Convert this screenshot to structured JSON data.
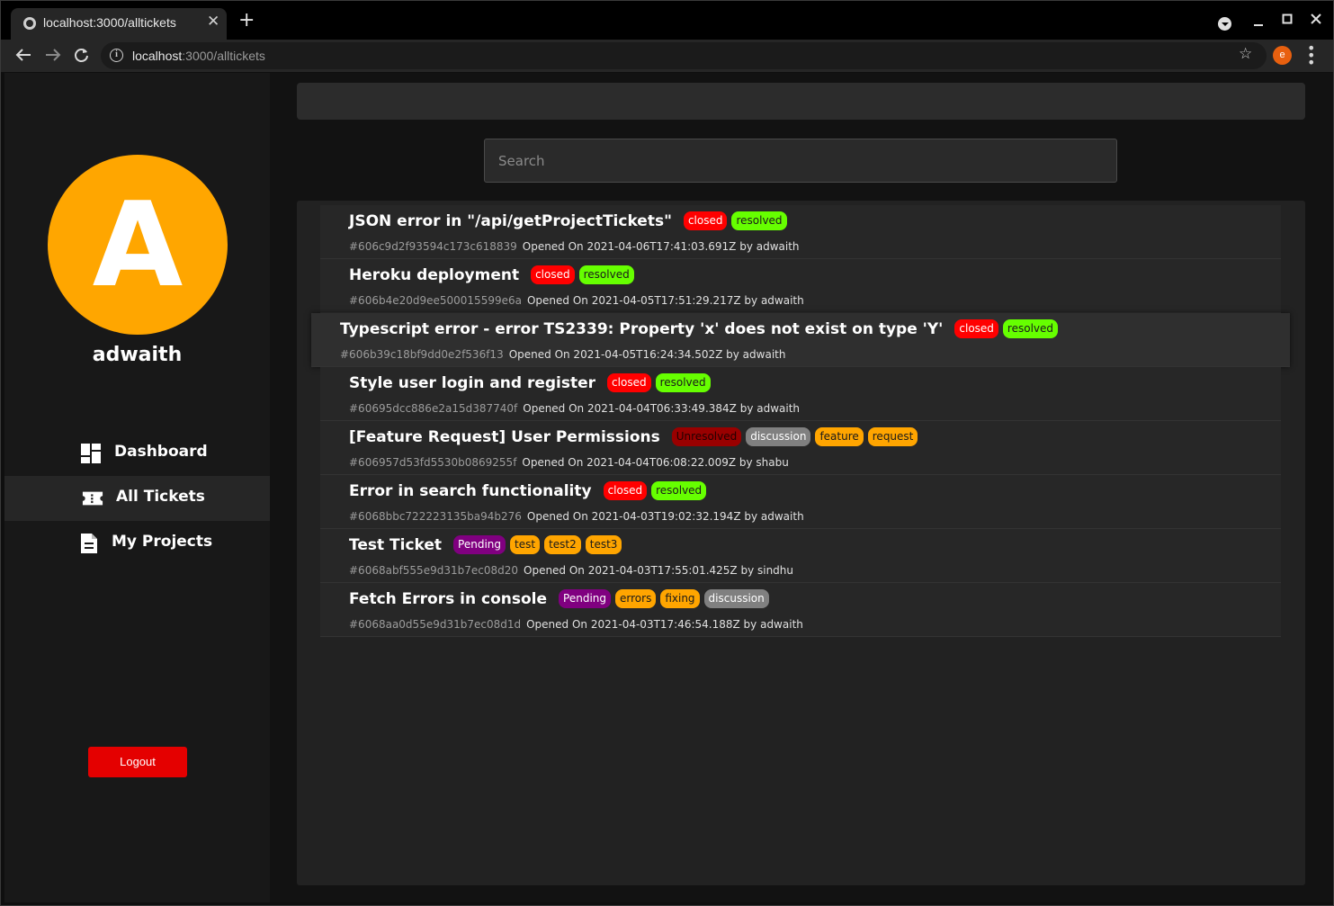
{
  "browser": {
    "tab_title": "localhost:3000/alltickets",
    "tab_close": "✕",
    "new_tab": "+",
    "url_host": "localhost",
    "url_path": ":3000/alltickets",
    "profile_initial": "e",
    "icons": [
      "globe-icon",
      "back-icon",
      "forward-icon",
      "reload-icon",
      "info-icon",
      "star-icon",
      "kebab-icon",
      "minimize-icon",
      "maximize-icon",
      "close-icon"
    ]
  },
  "sidebar": {
    "avatar_letter": "A",
    "avatar_color": "#ffa600",
    "username": "adwaith",
    "nav": [
      {
        "label": "Dashboard",
        "icon": "dashboard-icon",
        "active": false
      },
      {
        "label": "All Tickets",
        "icon": "ticket-icon",
        "active": true
      },
      {
        "label": "My Projects",
        "icon": "document-icon",
        "active": false
      }
    ],
    "logout_label": "Logout",
    "logout_color": "#e40000"
  },
  "search": {
    "placeholder": "Search"
  },
  "badge_colors": {
    "closed": {
      "bg": "#ff0000",
      "fg": "#ffffff"
    },
    "resolved": {
      "bg": "#66ff00",
      "fg": "#1a1a1a"
    },
    "Unresolved": {
      "bg": "#990000",
      "fg": "#220000"
    },
    "discussion": {
      "bg": "#808080",
      "fg": "#ffffff"
    },
    "Pending": {
      "bg": "#800080",
      "fg": "#ffffff"
    },
    "orange": {
      "bg": "#ffa500",
      "fg": "#1a1a1a"
    }
  },
  "tickets": [
    {
      "title": "JSON error in \"/api/getProjectTickets\"",
      "tags": [
        "closed",
        "resolved"
      ],
      "id": "#606c9d2f93594c173c618839",
      "opened": "Opened On 2021-04-06T17:41:03.691Z by adwaith"
    },
    {
      "title": "Heroku deployment",
      "tags": [
        "closed",
        "resolved"
      ],
      "id": "#606b4e20d9ee500015599e6a",
      "opened": "Opened On 2021-04-05T17:51:29.217Z by adwaith"
    },
    {
      "title": "Typescript error - error TS2339: Property 'x' does not exist on type 'Y'",
      "tags": [
        "closed",
        "resolved"
      ],
      "id": "#606b39c18bf9dd0e2f536f13",
      "opened": "Opened On 2021-04-05T16:24:34.502Z by adwaith"
    },
    {
      "title": "Style user login and register",
      "tags": [
        "closed",
        "resolved"
      ],
      "id": "#60695dcc886e2a15d387740f",
      "opened": "Opened On 2021-04-04T06:33:49.384Z by adwaith"
    },
    {
      "title": "[Feature Request] User Permissions",
      "tags": [
        "Unresolved",
        "discussion",
        "feature",
        "request"
      ],
      "id": "#606957d53fd5530b0869255f",
      "opened": "Opened On 2021-04-04T06:08:22.009Z by shabu"
    },
    {
      "title": "Error in search functionality",
      "tags": [
        "closed",
        "resolved"
      ],
      "id": "#6068bbc722223135ba94b276",
      "opened": "Opened On 2021-04-03T19:02:32.194Z by adwaith"
    },
    {
      "title": "Test Ticket",
      "tags": [
        "Pending",
        "test",
        "test2",
        "test3"
      ],
      "id": "#6068abf555e9d31b7ec08d20",
      "opened": "Opened On 2021-04-03T17:55:01.425Z by sindhu"
    },
    {
      "title": "Fetch Errors in console",
      "tags": [
        "Pending",
        "errors",
        "fixing",
        "discussion"
      ],
      "id": "#6068aa0d55e9d31b7ec08d1d",
      "opened": "Opened On 2021-04-03T17:46:54.188Z by adwaith"
    }
  ]
}
